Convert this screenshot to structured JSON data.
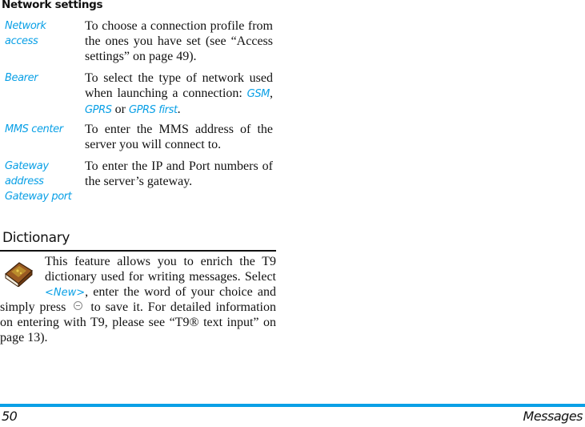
{
  "section": {
    "title": "Network settings",
    "rows": [
      {
        "term": "Network access",
        "desc": "To choose a connection profile from the ones you have set (see “Access settings” on page 49)."
      },
      {
        "term": "Bearer",
        "desc_pre": "To select the type of network used when launching a connection: ",
        "opt1": "GSM",
        "sep1": ", ",
        "opt2": "GPRS",
        "sep2": " or ",
        "opt3": "GPRS first",
        "desc_post": "."
      },
      {
        "term": "MMS center",
        "desc": "To enter the MMS address of the server you will connect to."
      },
      {
        "term": "Gateway address Gateway port",
        "desc": "To enter the IP and Port numbers of the server’s gateway."
      }
    ]
  },
  "dictionary": {
    "title": "Dictionary",
    "icon": "dictionary-book-icon",
    "text_pre": "This feature allows you to enrich the T9 dictionary used for writing messages. Select ",
    "new_label": "<New>",
    "text_mid": ", enter the word of your choice and simply press",
    "key_icon": "ok-key-icon",
    "text_post": "to save it. For detailed information on entering with T9, please see “T9® text input” on page 13)."
  },
  "footer": {
    "page_number": "50",
    "chapter": "Messages",
    "accent_color": "#0aa0e6"
  }
}
